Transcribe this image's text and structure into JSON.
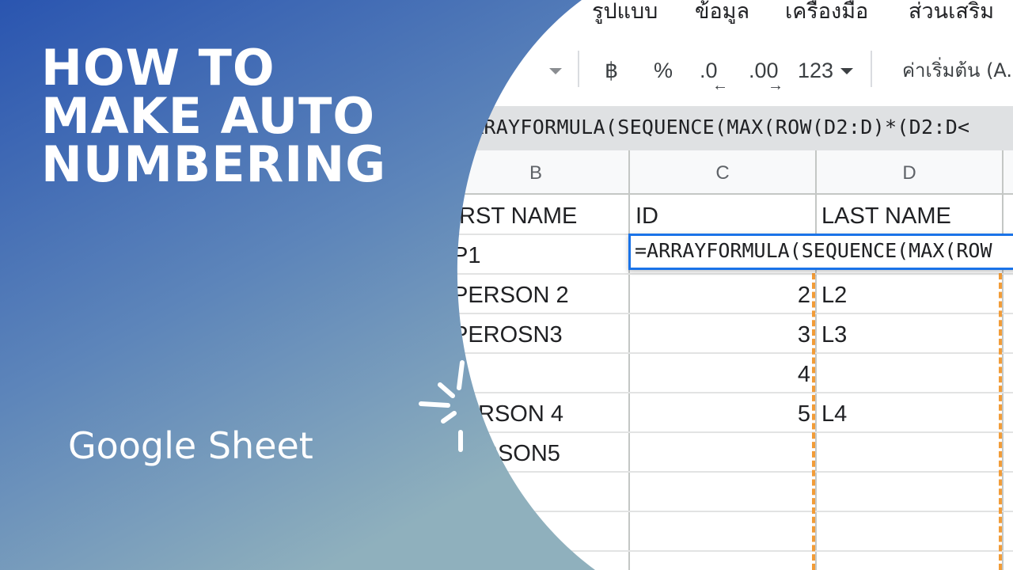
{
  "menu": [
    {
      "label": "รูปแบบ"
    },
    {
      "label": "ข้อมูล"
    },
    {
      "label": "เครื่องมือ"
    },
    {
      "label": "ส่วนเสริม"
    }
  ],
  "toolbar": {
    "currency": "฿",
    "percent": "%",
    "decrease_decimal": ".0",
    "increase_decimal": ".00",
    "more_formats": "123",
    "font": "ค่าเริ่มต้น (A..."
  },
  "formula_bar": {
    "text": "RRAYFORMULA(SEQUENCE(MAX(ROW(D2:D)*(D2:D<"
  },
  "columns": [
    "B",
    "C",
    "D"
  ],
  "header_row": {
    "b": "IRST NAME",
    "c": "ID",
    "d": "LAST NAME"
  },
  "rows": [
    {
      "b": "P1",
      "c": "",
      "d": ""
    },
    {
      "b": "PERSON 2",
      "c": "2",
      "d": "L2"
    },
    {
      "b": "PEROSN3",
      "c": "3",
      "d": "L3"
    },
    {
      "b": "",
      "c": "4",
      "d": ""
    },
    {
      "b": "RSON 4",
      "c": "5",
      "d": "L4"
    },
    {
      "b": "RSON5",
      "c": "",
      "d": ""
    }
  ],
  "active_cell": {
    "text": "=ARRAYFORMULA(SEQUENCE(MAX(ROW"
  },
  "overlay": {
    "title_lines": [
      "HOW TO",
      "MAKE AUTO",
      "NUMBERING"
    ],
    "subtitle": "Google Sheet",
    "colors": {
      "gradient_top": "#2a55b0",
      "gradient_bottom": "#8fb0bd",
      "accent_dash": "#f29c38",
      "selection": "#1a73e8"
    }
  }
}
